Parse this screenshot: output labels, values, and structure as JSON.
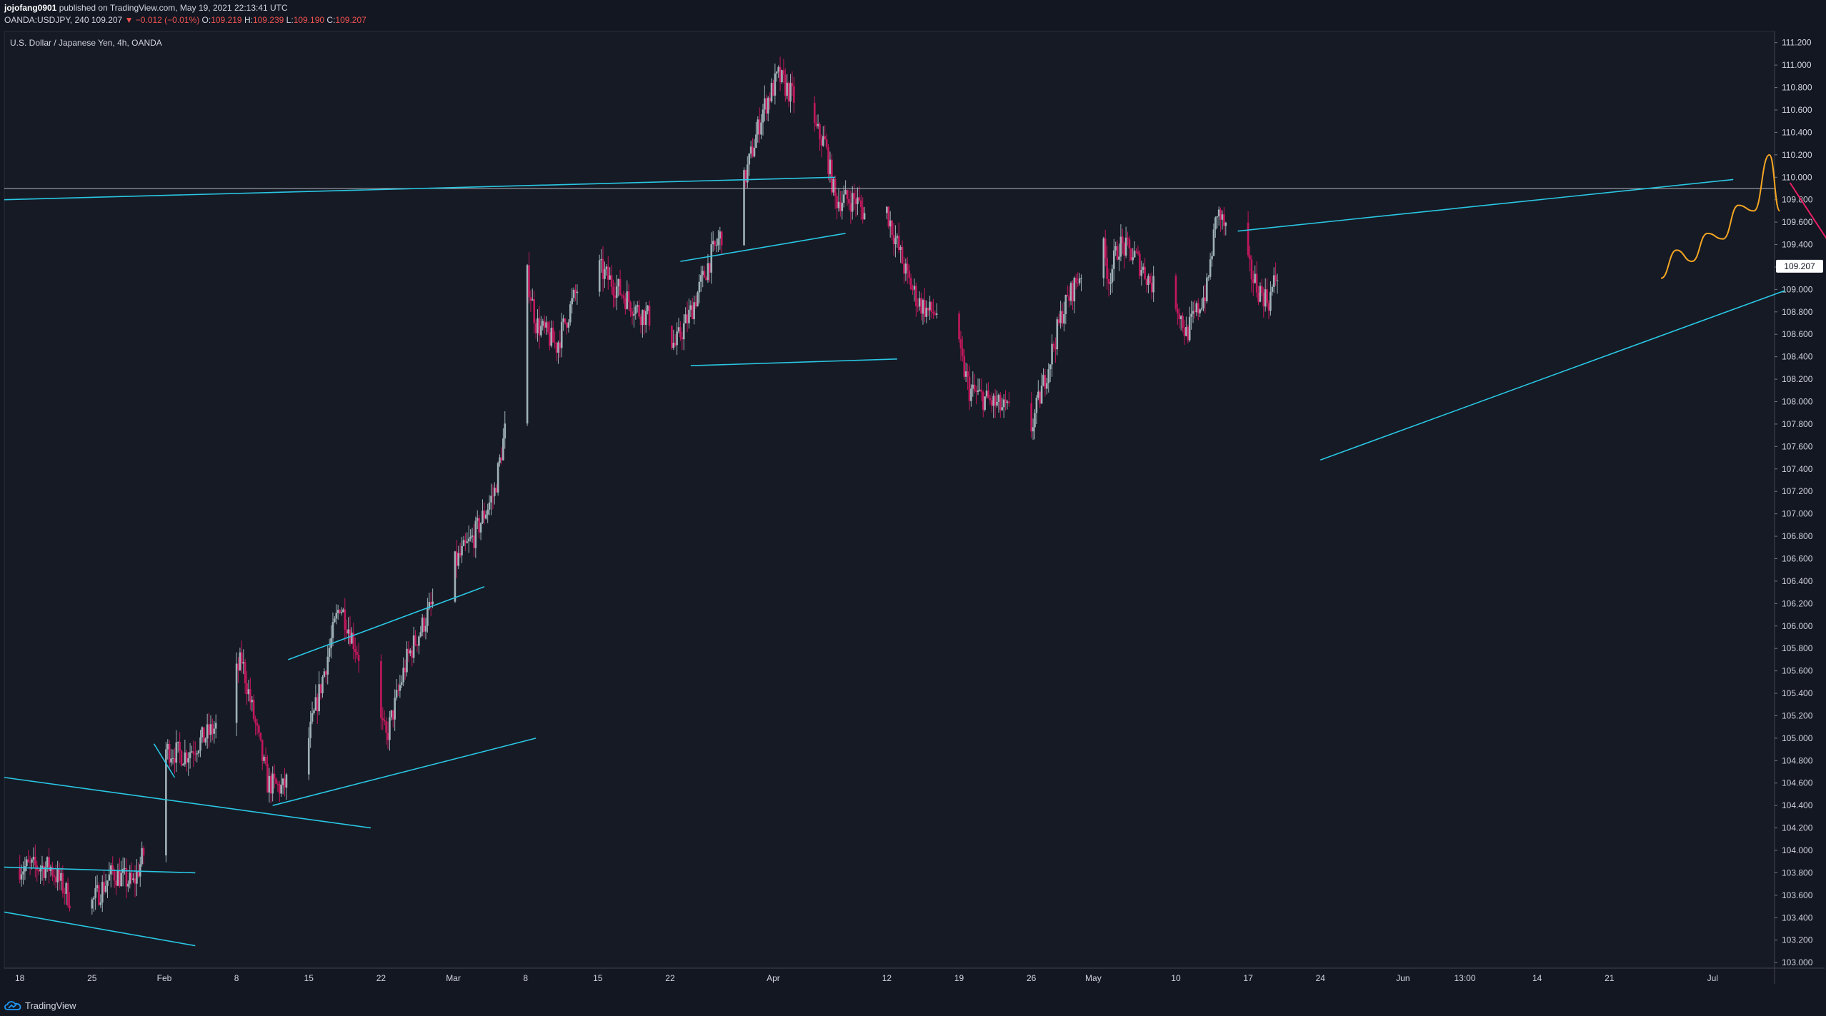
{
  "header": {
    "author": "jojofang0901",
    "published_text": "published on TradingView.com, May 19, 2021 22:13:41 UTC",
    "symbol": "OANDA:USDJPY, 240",
    "last": "109.207",
    "change": "▼ −0.012 (−0.01%)",
    "open_label": "O:",
    "open": "109.219",
    "high_label": "H:",
    "high": "109.239",
    "low_label": "L:",
    "low": "109.190",
    "close_label": "C:",
    "close": "109.207"
  },
  "symbol_title": "U.S. Dollar / Japanese Yen, 4h, OANDA",
  "brand": "TradingView",
  "colors": {
    "background": "#131722",
    "up_candle": "#9fb1b8",
    "down_candle": "#c2185b",
    "trendline": "#29c7e3",
    "projection": "#f5a623",
    "forecast_arrow": "#e91e63",
    "price_tag": "#ffffff"
  },
  "chart_data": {
    "type": "candlestick",
    "instrument": "USDJPY",
    "timeframe": "4h",
    "ylim": [
      102.95,
      111.3
    ],
    "y_ticks": [
      "111.200",
      "111.000",
      "110.800",
      "110.600",
      "110.400",
      "110.200",
      "110.000",
      "109.800",
      "109.600",
      "109.400",
      "109.200",
      "109.000",
      "108.800",
      "108.600",
      "108.400",
      "108.200",
      "108.000",
      "107.800",
      "107.600",
      "107.400",
      "107.200",
      "107.000",
      "106.800",
      "106.600",
      "106.400",
      "106.200",
      "106.000",
      "105.800",
      "105.600",
      "105.400",
      "105.200",
      "105.000",
      "104.800",
      "104.600",
      "104.400",
      "104.200",
      "104.000",
      "103.800",
      "103.600",
      "103.400",
      "103.200",
      "103.000"
    ],
    "x_ticks": [
      {
        "label": "18",
        "day": 0
      },
      {
        "label": "25",
        "day": 7
      },
      {
        "label": "Feb",
        "day": 14
      },
      {
        "label": "8",
        "day": 21
      },
      {
        "label": "15",
        "day": 28
      },
      {
        "label": "22",
        "day": 35
      },
      {
        "label": "Mar",
        "day": 42
      },
      {
        "label": "8",
        "day": 49
      },
      {
        "label": "15",
        "day": 56
      },
      {
        "label": "22",
        "day": 63
      },
      {
        "label": "Apr",
        "day": 73
      },
      {
        "label": "12",
        "day": 84
      },
      {
        "label": "19",
        "day": 91
      },
      {
        "label": "26",
        "day": 98
      },
      {
        "label": "May",
        "day": 104
      },
      {
        "label": "10",
        "day": 112
      },
      {
        "label": "17",
        "day": 119
      },
      {
        "label": "24",
        "day": 126
      },
      {
        "label": "Jun",
        "day": 134
      },
      {
        "label": "13:00",
        "day": 140
      },
      {
        "label": "14",
        "day": 147
      },
      {
        "label": "21",
        "day": 154
      },
      {
        "label": "Jul",
        "day": 164
      }
    ],
    "x_range_days": [
      -1.5,
      170
    ],
    "last_price": 109.207,
    "horizontal_level": 109.9,
    "price_path": [
      [
        0,
        103.85
      ],
      [
        3,
        103.85
      ],
      [
        6,
        103.4
      ],
      [
        9,
        103.8
      ],
      [
        11,
        103.7
      ],
      [
        12.5,
        104.1
      ],
      [
        14,
        104.9
      ],
      [
        16,
        104.85
      ],
      [
        19,
        105.1
      ],
      [
        21.5,
        105.7
      ],
      [
        24,
        104.6
      ],
      [
        25.5,
        104.55
      ],
      [
        28,
        105.0
      ],
      [
        31,
        106.2
      ],
      [
        33,
        105.7
      ],
      [
        35.5,
        105.0
      ],
      [
        37.5,
        105.7
      ],
      [
        41,
        106.4
      ],
      [
        44,
        106.8
      ],
      [
        46,
        107.2
      ],
      [
        47.5,
        108.0
      ],
      [
        49,
        109.2
      ],
      [
        50,
        108.7
      ],
      [
        52,
        108.5
      ],
      [
        54,
        109.0
      ],
      [
        56,
        109.2
      ],
      [
        58,
        109.0
      ],
      [
        60,
        108.8
      ],
      [
        62,
        108.7
      ],
      [
        63.5,
        108.5
      ],
      [
        65,
        108.8
      ],
      [
        67,
        109.3
      ],
      [
        70,
        109.9
      ],
      [
        72,
        110.6
      ],
      [
        73.5,
        110.9
      ],
      [
        75,
        110.7
      ],
      [
        76.5,
        110.5
      ],
      [
        78,
        110.3
      ],
      [
        79,
        109.8
      ],
      [
        81,
        109.8
      ],
      [
        83,
        109.5
      ],
      [
        84,
        109.7
      ],
      [
        85,
        109.4
      ],
      [
        86,
        109.1
      ],
      [
        87,
        108.9
      ],
      [
        88,
        108.8
      ],
      [
        90,
        108.8
      ],
      [
        92,
        108.1
      ],
      [
        94,
        108.0
      ],
      [
        96,
        107.9
      ],
      [
        97.5,
        107.6
      ],
      [
        99,
        108.1
      ],
      [
        101,
        108.8
      ],
      [
        103,
        109.2
      ],
      [
        104.5,
        109.6
      ],
      [
        105.5,
        109.1
      ],
      [
        106.5,
        109.4
      ],
      [
        108,
        109.3
      ],
      [
        110,
        109.0
      ],
      [
        111,
        108.6
      ],
      [
        112,
        108.9
      ],
      [
        113,
        108.6
      ],
      [
        115,
        109.0
      ],
      [
        116,
        109.7
      ],
      [
        117,
        109.5
      ],
      [
        118,
        109.4
      ],
      [
        119,
        109.2
      ],
      [
        120,
        109.0
      ],
      [
        121,
        108.9
      ],
      [
        122,
        109.2
      ]
    ],
    "trendlines": [
      {
        "from": [
          -1.5,
          109.8
        ],
        "to": [
          79,
          110.0
        ]
      },
      {
        "from": [
          -1.5,
          103.85
        ],
        "to": [
          17,
          103.8
        ]
      },
      {
        "from": [
          -1.5,
          103.45
        ],
        "to": [
          17,
          103.15
        ]
      },
      {
        "from": [
          -1.5,
          104.65
        ],
        "to": [
          34,
          104.2
        ]
      },
      {
        "from": [
          13,
          104.95
        ],
        "to": [
          15,
          104.65
        ]
      },
      {
        "from": [
          26,
          105.7
        ],
        "to": [
          45,
          106.35
        ]
      },
      {
        "from": [
          24.5,
          104.4
        ],
        "to": [
          50,
          105.0
        ]
      },
      {
        "from": [
          64,
          109.25
        ],
        "to": [
          80,
          109.5
        ]
      },
      {
        "from": [
          65,
          108.32
        ],
        "to": [
          85,
          108.38
        ]
      },
      {
        "from": [
          118,
          109.52
        ],
        "to": [
          166,
          109.98
        ]
      },
      {
        "from": [
          126,
          107.48
        ],
        "to": [
          171,
          108.99
        ]
      }
    ],
    "projection_path": [
      [
        159,
        109.1
      ],
      [
        160.5,
        109.35
      ],
      [
        162,
        109.25
      ],
      [
        163.5,
        109.5
      ],
      [
        165,
        109.45
      ],
      [
        166.5,
        109.75
      ],
      [
        168,
        109.7
      ],
      [
        169.5,
        110.2
      ],
      [
        170.5,
        109.7
      ]
    ],
    "forecast_arrow": {
      "from": [
        171.5,
        109.95
      ],
      "to": [
        188,
        107.63
      ]
    }
  }
}
